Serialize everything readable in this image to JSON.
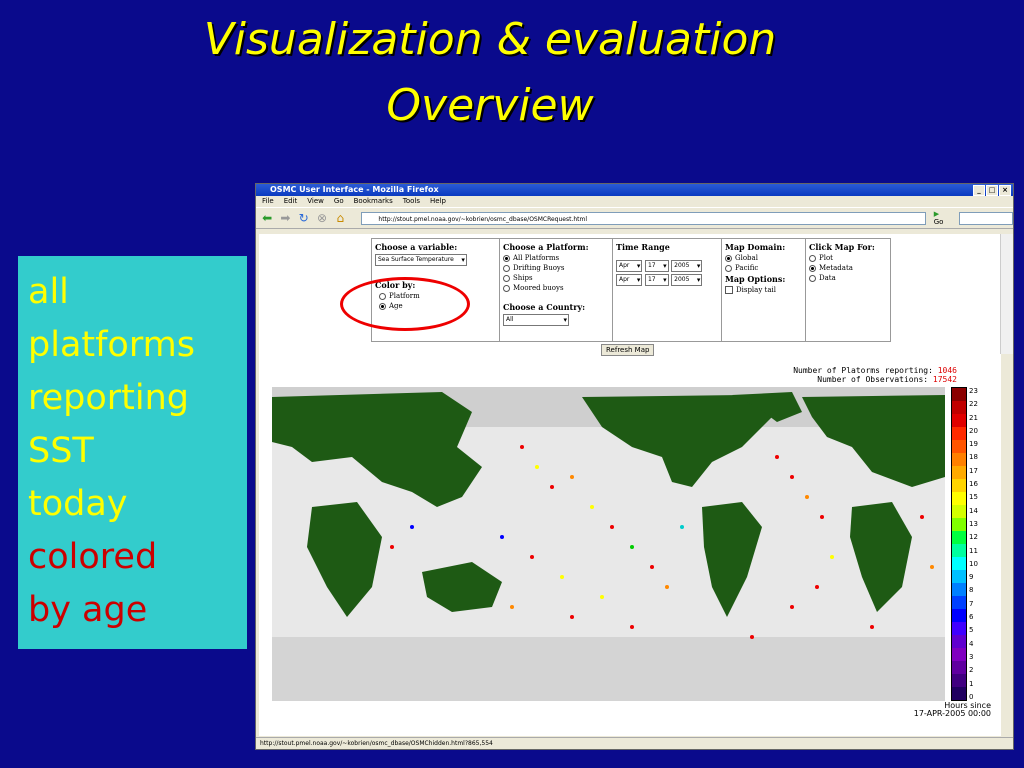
{
  "slide": {
    "title_line1": "Visualization & evaluation",
    "title_line2": "Overview",
    "side_text": [
      "all",
      "platforms",
      "reporting",
      "SST",
      "today"
    ],
    "side_text_red": [
      "colored",
      "by age"
    ]
  },
  "browser": {
    "window_title": "OSMC User Interface - Mozilla Firefox",
    "menus": [
      "File",
      "Edit",
      "View",
      "Go",
      "Bookmarks",
      "Tools",
      "Help"
    ],
    "url": "http://stout.pmel.noaa.gov/~kobrien/osmc_dbase/OSMCRequest.html",
    "go_label": "Go",
    "status_url": "http://stout.pmel.noaa.gov/~kobrien/osmc_dbase/OSMChidden.html?865,554"
  },
  "form": {
    "variable_label": "Choose a variable:",
    "variable_value": "Sea Surface Temperature",
    "colorby_label": "Color by:",
    "colorby_options": [
      "Platform",
      "Age"
    ],
    "platform_label": "Choose a Platform:",
    "platform_options": [
      "All Platforms",
      "Drifting Buoys",
      "Ships",
      "Moored buoys"
    ],
    "country_label": "Choose a Country:",
    "country_value": "All",
    "time_label": "Time Range",
    "start_month": "Apr",
    "start_day": "17",
    "start_year": "2005",
    "end_month": "Apr",
    "end_day": "17",
    "end_year": "2005",
    "domain_label": "Map Domain:",
    "domain_options": [
      "Global",
      "Pacific"
    ],
    "options_label": "Map Options:",
    "display_tail": "Display tail",
    "click_label": "Click Map For:",
    "click_options": [
      "Plot",
      "Metadata",
      "Data"
    ],
    "refresh_label": "Refresh Map"
  },
  "stats": {
    "platforms_label": "Number of Platorms reporting:",
    "platforms_value": "1046",
    "obs_label": "Number of Observations:",
    "obs_value": "17542"
  },
  "legend": {
    "ticks": [
      "23",
      "22",
      "21",
      "20",
      "19",
      "18",
      "17",
      "16",
      "15",
      "14",
      "13",
      "12",
      "11",
      "10",
      "9",
      "8",
      "7",
      "6",
      "5",
      "4",
      "3",
      "2",
      "1",
      "0"
    ],
    "hours_label": "Hours since",
    "hours_date": "17-APR-2005 00:00"
  },
  "colors": {
    "background": "#0a0a8c",
    "title": "#ffff00",
    "sidebox": "#33cccc",
    "red": "#cc0000",
    "land": "#1e5a14"
  }
}
